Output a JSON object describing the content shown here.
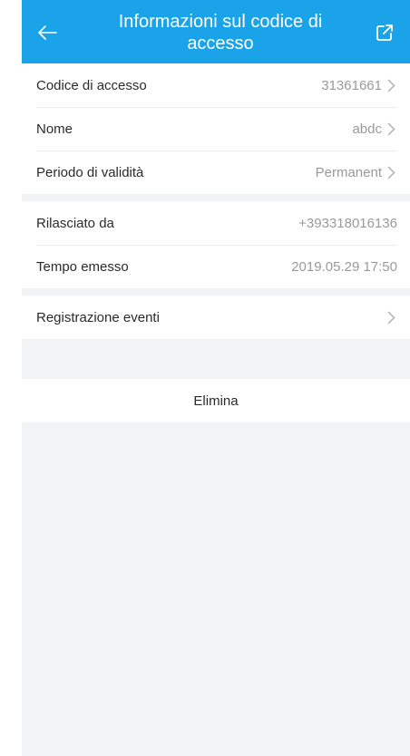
{
  "header": {
    "title": "Informazioni sul codice di accesso",
    "back_icon": "arrow-left-icon",
    "share_icon": "external-link-icon",
    "color": "#1aa3e8"
  },
  "details": [
    {
      "label": "Codice di accesso",
      "value": "31361661",
      "chevron": true
    },
    {
      "label": "Nome",
      "value": "abdc",
      "chevron": true
    },
    {
      "label": "Periodo di validità",
      "value": "Permanent",
      "chevron": true
    }
  ],
  "issue_info": [
    {
      "label": "Rilasciato da",
      "value": "+393318016136"
    },
    {
      "label": "Tempo emesso",
      "value": "2019.05.29 17:50"
    }
  ],
  "events": {
    "label": "Registrazione eventi"
  },
  "actions": {
    "delete_label": "Elimina"
  }
}
